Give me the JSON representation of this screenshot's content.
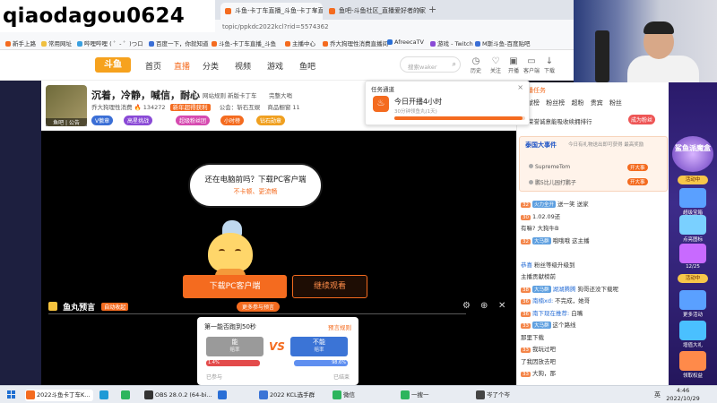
{
  "overlay": {
    "streamer_name": "qiaodagou0624"
  },
  "browser": {
    "tabs": [
      {
        "label": "斗鱼-卡丁车直播_斗鱼-卡丁车直播",
        "active": true
      },
      {
        "label": "鱼吧-斗鱼社区_直播爱好者的家",
        "active": false
      }
    ],
    "new_tab": "+",
    "url": "topic/ppkdc2022kcl?rid=5574362",
    "bookmarks": [
      "新手上路",
      "常用网址",
      "哔哩哔哩 ( ゜- ゜)つロ",
      "百度一下，你就知道",
      "斗鱼-卡丁车直播_斗鱼",
      "主播中心",
      "乔大狗理性消费直播间",
      "AfreecaTV",
      "游戏 - Twitch",
      "M斯斗鱼-百度贴吧"
    ]
  },
  "site": {
    "logo": "斗鱼",
    "nav": [
      "首页",
      "直播",
      "分类",
      "视频",
      "游戏",
      "鱼吧"
    ],
    "nav_active": "直播",
    "search_placeholder": "搜索waker",
    "header_icons": [
      "历史",
      "关注",
      "开播",
      "客户端",
      "下载"
    ]
  },
  "room": {
    "title": "沉着，冷静，喊信，耐心",
    "links": [
      "举报",
      "网站规则",
      "新版卡丁车",
      "完整大哨"
    ],
    "owner": "乔大狗理性消费",
    "heat": "134272",
    "sponsor": "新年超得获利",
    "announce": "公会：斩石互娱",
    "mall": "商品橱窗 11",
    "avatar_label": "鱼吧 | 公告",
    "badges": [
      "V徽章",
      "高星挑战",
      "超级粉丝团",
      "小时榜",
      "钻石勋章"
    ]
  },
  "player": {
    "promo_line1": "还在电脑前吗？下载PC客户端",
    "promo_line2": "不卡顿、更流畅",
    "download_btn": "下载PC客户端",
    "continue_btn": "继续观看",
    "prediction_label": "鱼丸预言",
    "prediction_tag": "自动收起",
    "prediction_pill": "更多参与预言",
    "prediction": {
      "question": "第一能否跑到50秒",
      "rule": "预言规则",
      "option_a": "能",
      "option_a_sub": "赔率",
      "option_b": "不能",
      "option_b_sub": "赔率",
      "vs": "VS",
      "pool_a": "1.4%",
      "pool_b": "98.6%",
      "share_a": 0.014,
      "share_b": 0.986,
      "foot_left": "已参与",
      "foot_right": "已结束"
    }
  },
  "task": {
    "title": "任务通道",
    "name": "今日开播4小时",
    "sub": "30分钟领鱼丸(1天)",
    "progress": 0.98
  },
  "sidebar": {
    "rank_tabs": [
      "主播任务",
      "贡献榜",
      "粉丝榜",
      "超粉",
      "贵宾",
      "粉丝"
    ],
    "rank_line": "荣誉诚意能吸收续拥排行",
    "rank_btn": "成为粉丝",
    "event_title": "泰国大事件",
    "event_sub": "今日有礼物送出即可获得 最高奖励",
    "event_entries": [
      {
        "name": "SupremeTom",
        "tag": "开大事"
      },
      {
        "name": "鹏5比儿园打鹏子",
        "tag": "开大事"
      }
    ],
    "chat": [
      {
        "lvl": "32",
        "fan": "火力全开",
        "user": "",
        "text": "送一笑 送家"
      },
      {
        "lvl": "30",
        "fan": "",
        "user": "",
        "text": "1.02.09还"
      },
      {
        "lvl": "",
        "fan": "",
        "user": "",
        "text": "有嘛? 大狗牛B"
      },
      {
        "lvl": "32",
        "fan": "大马群",
        "user": "",
        "text": "哦哦哦 这主播"
      },
      {
        "lvl": "",
        "fan": "",
        "user": "",
        "text": ""
      },
      {
        "lvl": "",
        "fan": "",
        "user": "恭喜",
        "text": "粉丝等级升级到"
      },
      {
        "lvl": "",
        "fan": "",
        "user": "",
        "text": "主播贡献榜前"
      },
      {
        "lvl": "38",
        "fan": "大马群",
        "user": "湖湖腾腾",
        "text": "狗哥还没下载呢"
      },
      {
        "lvl": "36",
        "fan": "",
        "user": "南楠xd:",
        "text": "不完成，她哥"
      },
      {
        "lvl": "36",
        "fan": "",
        "user": "南下现在推荐:",
        "text": "白嘴"
      },
      {
        "lvl": "33",
        "fan": "大马群",
        "user": "",
        "text": "这个路线"
      },
      {
        "lvl": "",
        "fan": "",
        "user": "",
        "text": "那里下载"
      },
      {
        "lvl": "33",
        "fan": "",
        "user": "",
        "text": "我玩过吧"
      },
      {
        "lvl": "",
        "fan": "",
        "user": "",
        "text": "了我因放去吧"
      },
      {
        "lvl": "33",
        "fan": "",
        "user": "",
        "text": "大狗，那"
      }
    ]
  },
  "ad": {
    "badge": "鲨鱼派魔盒",
    "items": [
      "超级宝箱",
      "点亮图标",
      "12/25",
      "更多活动",
      "增值大礼",
      "领取权益"
    ],
    "labels": [
      "活动中",
      "活动中"
    ]
  },
  "taskbar": {
    "apps": [
      {
        "label": "2022斗鱼卡丁车K...",
        "active": true
      },
      {
        "label": "",
        "active": false
      },
      {
        "label": "",
        "active": false
      },
      {
        "label": "OBS 28.0.2 (64-bi...",
        "active": false
      },
      {
        "label": "",
        "active": false
      },
      {
        "label": "2022 KCL选手群",
        "active": false
      },
      {
        "label": "微信",
        "active": false
      },
      {
        "label": "一搜一",
        "active": false
      },
      {
        "label": "岑了个岑",
        "active": false
      }
    ],
    "tray": "英",
    "time": "4:46",
    "date": "2022/10/29"
  },
  "colors": {
    "accent": "#f46b1f",
    "link": "#2a6fd6",
    "dark_bg": "#1d1f3f"
  }
}
